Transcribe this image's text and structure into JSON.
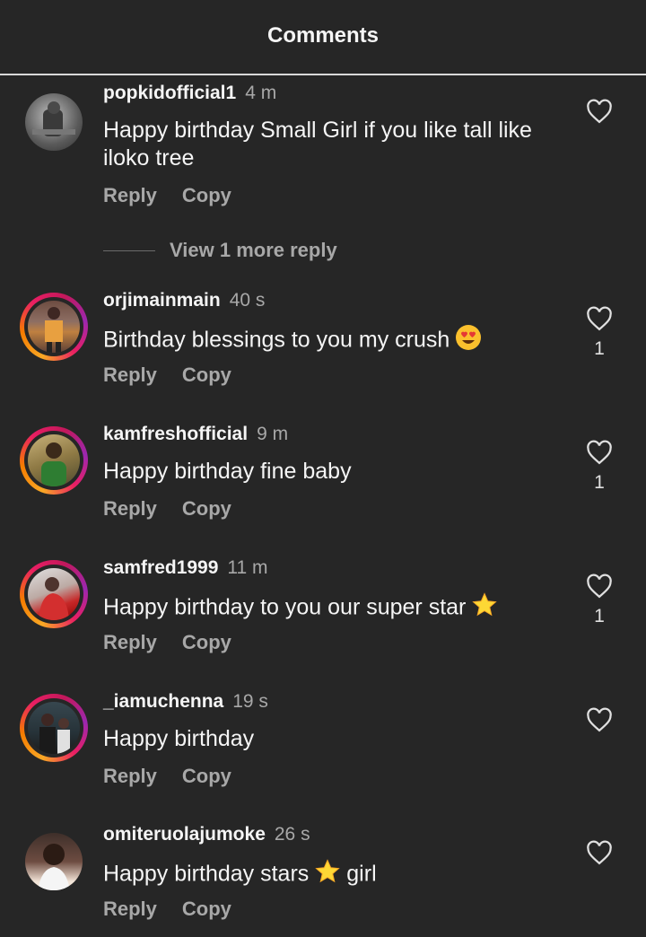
{
  "header": {
    "title": "Comments"
  },
  "comments": [
    {
      "username": "popkidofficial1",
      "time": "4 m",
      "text": "Happy birthday Small Girl if you like tall like iloko tree",
      "reply_label": "Reply",
      "copy_label": "Copy",
      "likes": ""
    },
    {
      "username": "orjimainmain",
      "time": "40 s",
      "text": "Birthday blessings to you my crush",
      "emoji": "heart-eyes-emoji",
      "reply_label": "Reply",
      "copy_label": "Copy",
      "likes": "1"
    },
    {
      "username": "kamfreshofficial",
      "time": "9 m",
      "text": "Happy birthday fine baby",
      "reply_label": "Reply",
      "copy_label": "Copy",
      "likes": "1"
    },
    {
      "username": "samfred1999",
      "time": "11 m",
      "text": "Happy birthday to you our super star",
      "emoji": "star-emoji",
      "reply_label": "Reply",
      "copy_label": "Copy",
      "likes": "1"
    },
    {
      "username": "_iamuchenna",
      "time": "19 s",
      "text": "Happy birthday",
      "reply_label": "Reply",
      "copy_label": "Copy",
      "likes": ""
    },
    {
      "username": "omiteruolajumoke",
      "time": "26 s",
      "text_before": "Happy birthday stars",
      "text_after": "girl",
      "emoji": "star-emoji",
      "reply_label": "Reply",
      "copy_label": "Copy",
      "likes": ""
    }
  ],
  "view_more_replies": "View 1 more reply",
  "colors": {
    "background": "#262626",
    "secondary_text": "#a8a8a8",
    "story_ring_start": "#f9a825",
    "story_ring_end": "#c2185b"
  }
}
